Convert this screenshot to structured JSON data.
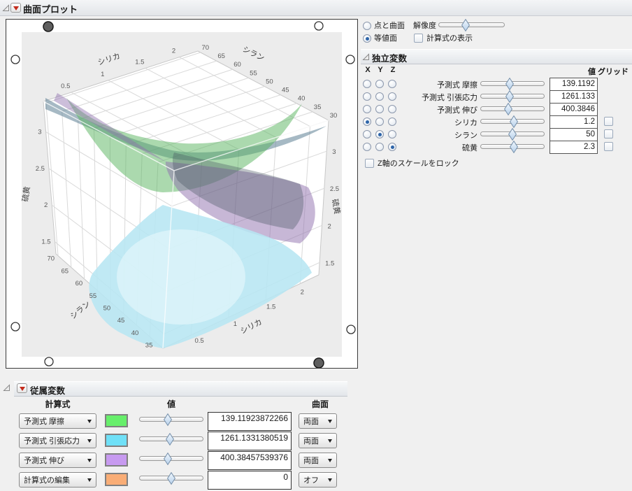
{
  "outline": {
    "plot_title": "曲面プロット",
    "independent_title": "独立変数",
    "dependent_title": "従属変数"
  },
  "display_controls": {
    "mode": "iso",
    "points_surface_label": "点と曲面",
    "resolution_label": "解像度",
    "resolution_slider_pos": 0.4,
    "isosurface_label": "等値面",
    "show_formula_label": "計算式の表示",
    "show_formula_checked": false
  },
  "independent": {
    "axis_headers": {
      "x": "X",
      "y": "Y",
      "z": "Z"
    },
    "value_header": "値",
    "grid_header": "グリッド",
    "lock_z_label": "Z軸のスケールをロック",
    "lock_z_checked": false,
    "rows": [
      {
        "label": "予測式 摩擦",
        "axis": "",
        "slider_pos": 0.45,
        "value": "139.1192",
        "has_grid": false,
        "grid_checked": false
      },
      {
        "label": "予測式 引張応力",
        "axis": "",
        "slider_pos": 0.45,
        "value": "1261.133",
        "has_grid": false,
        "grid_checked": false
      },
      {
        "label": "予測式 伸び",
        "axis": "",
        "slider_pos": 0.42,
        "value": "400.3846",
        "has_grid": false,
        "grid_checked": false
      },
      {
        "label": "シリカ",
        "axis": "X",
        "slider_pos": 0.53,
        "value": "1.2",
        "has_grid": true,
        "grid_checked": false
      },
      {
        "label": "シラン",
        "axis": "Y",
        "slider_pos": 0.5,
        "value": "50",
        "has_grid": true,
        "grid_checked": false
      },
      {
        "label": "硫黄",
        "axis": "Z",
        "slider_pos": 0.52,
        "value": "2.3",
        "has_grid": true,
        "grid_checked": false
      }
    ]
  },
  "dependent": {
    "formula_header": "計算式",
    "value_header": "値",
    "surface_header": "曲面",
    "rows": [
      {
        "formula": "予測式 摩擦",
        "color": "#67ef6b",
        "slider_pos": 0.44,
        "value": "139.11923872266",
        "surface": "両面"
      },
      {
        "formula": "予測式 引張応力",
        "color": "#6fe0f7",
        "slider_pos": 0.48,
        "value": "1261.1331380519",
        "surface": "両面"
      },
      {
        "formula": "予測式 伸び",
        "color": "#c79af0",
        "slider_pos": 0.44,
        "value": "400.38457539376",
        "surface": "両面"
      },
      {
        "formula": "計算式の編集",
        "color": "#f9ad76",
        "slider_pos": 0.5,
        "value": "0",
        "surface": "オフ"
      }
    ]
  },
  "chart_data": {
    "type": "surface3d",
    "mode": "isosurface",
    "title": "",
    "axes": {
      "x": {
        "label": "シリカ",
        "range": [
          0.5,
          2
        ],
        "ticks_top": [
          "0.5",
          "1",
          "1.5",
          "2"
        ],
        "ticks_bottom": [
          "0.5",
          "1",
          "1.5",
          "2"
        ]
      },
      "y": {
        "label": "シラン",
        "range": [
          70,
          30
        ],
        "ticks_top": [
          "70",
          "65",
          "60",
          "55",
          "50",
          "45",
          "40",
          "35",
          "30"
        ],
        "ticks_bottom": [
          "70",
          "65",
          "60",
          "55",
          "50",
          "45",
          "40",
          "35"
        ]
      },
      "z": {
        "label": "硫黄",
        "range": [
          3,
          1.5
        ],
        "ticks_left": [
          "3",
          "2.5",
          "2",
          "1.5"
        ],
        "ticks_right": [
          "3",
          "2.5",
          "2",
          "1.5"
        ]
      }
    },
    "surfaces": [
      {
        "name": "予測式 摩擦",
        "color": "#67ef6b",
        "render_fill": "#57b35e",
        "isovalue": 139.11923872266
      },
      {
        "name": "予測式 引張応力",
        "color": "#6fe0f7",
        "render_fill": "#5d7f93",
        "isovalue": 1261.1331380519
      },
      {
        "name": "予測式 伸び",
        "color": "#c79af0",
        "render_fill": "#8f6fae",
        "isovalue": 400.38457539376
      }
    ],
    "current_point": {
      "シリカ": 1.2,
      "シラン": 50,
      "硫黄": 2.3
    }
  }
}
